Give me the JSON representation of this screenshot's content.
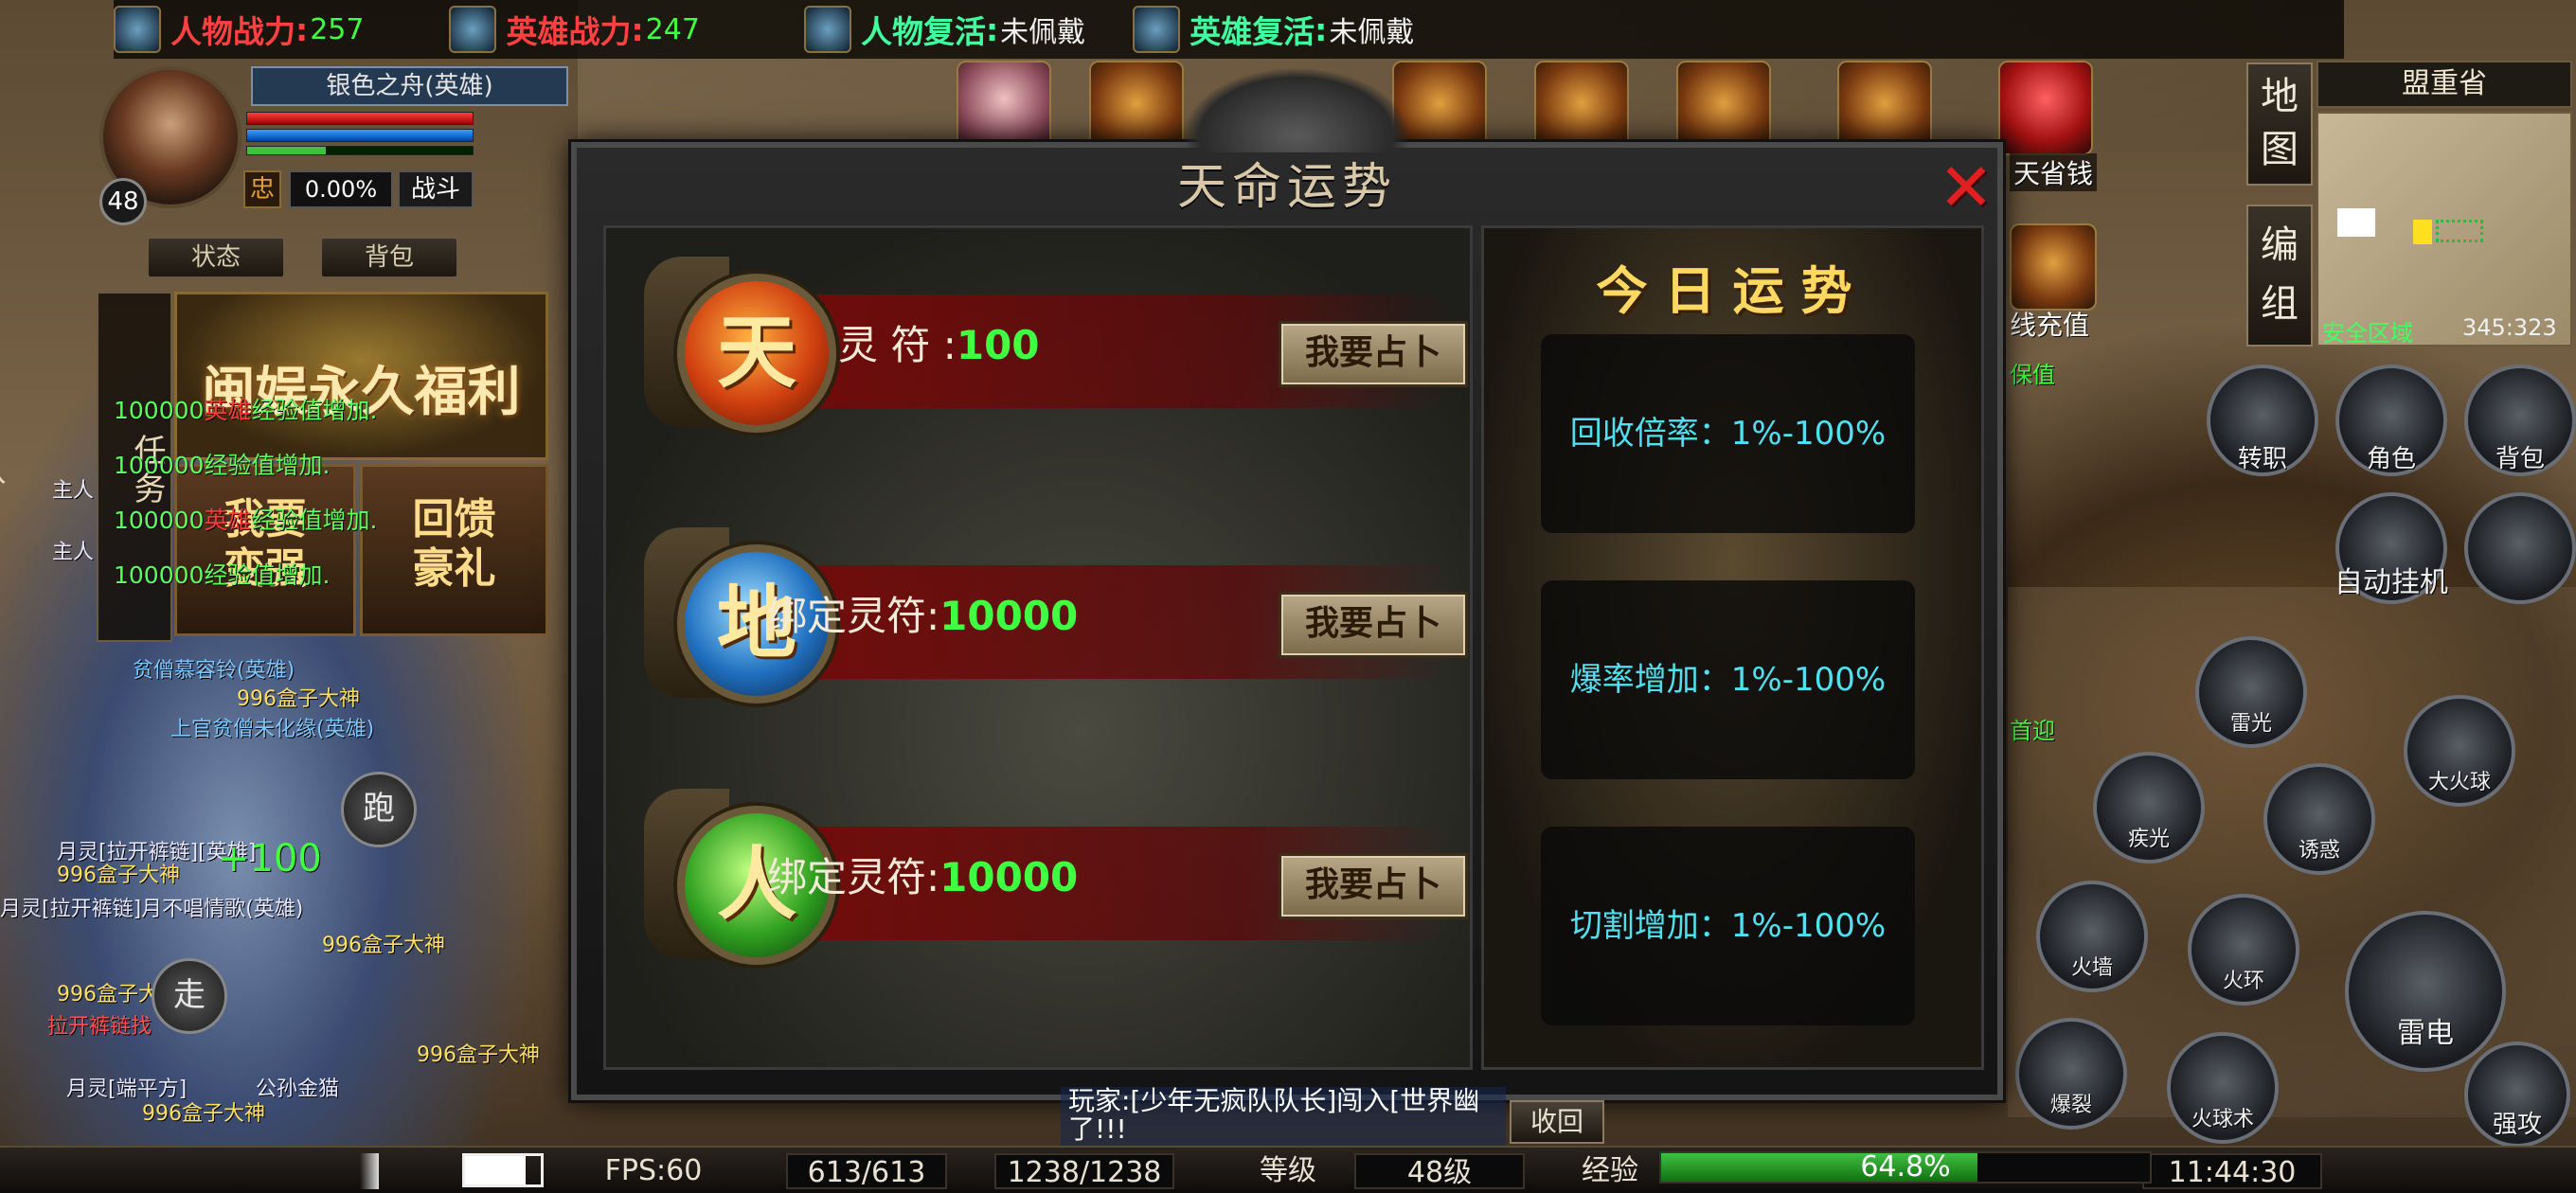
{
  "top_stats": [
    {
      "label": "人物战力",
      "value": "257",
      "label_color": "#ff4040",
      "value_color": "#40ff40",
      "icon": "dragon-icon"
    },
    {
      "label": "英雄战力",
      "value": "247",
      "label_color": "#ff4040",
      "value_color": "#40ff40",
      "icon": "flame-icon"
    },
    {
      "label": "人物复活",
      "value": "未佩戴",
      "label_color": "#40ffa0",
      "value_color": "#f0f0f0",
      "icon": "jade-icon"
    },
    {
      "label": "英雄复活",
      "value": "未佩戴",
      "label_color": "#40ffa0",
      "value_color": "#f0f0f0",
      "icon": "swirl-icon"
    }
  ],
  "hero": {
    "name": "银色之舟(英雄)",
    "level": "48",
    "loyalty_icon": "忠",
    "loyalty_pct": "0.00%",
    "mode": "战斗",
    "hp_fill": 1.0,
    "mp_fill": 1.0,
    "exp_fill": 0.35,
    "status_btn": "状态",
    "bag_btn": "背包"
  },
  "left_panel": {
    "task_tab": "任务",
    "team_tab": "队",
    "promo_main": "闽娱永久福利",
    "promo_a": [
      "我要",
      "变强"
    ],
    "promo_b": [
      "回馈",
      "豪礼"
    ]
  },
  "system_log": [
    {
      "amount": "100000",
      "hero": "英雄",
      "text": "经验值增加."
    },
    {
      "amount": "100000",
      "hero": "",
      "text": "经验值增加."
    },
    {
      "amount": "100000",
      "hero": "英雄",
      "text": "经验值增加."
    },
    {
      "amount": "100000",
      "hero": "",
      "text": "经验值增加."
    }
  ],
  "float_names": [
    {
      "text": "主人",
      "cls": "w"
    },
    {
      "text": "主人",
      "cls": "w"
    },
    {
      "text": "贫僧慕容铃(英雄)",
      "cls": "b"
    },
    {
      "text": "996盒子大神",
      "cls": ""
    },
    {
      "text": "上官贫僧未化缘(英雄)",
      "cls": "b"
    },
    {
      "text": "月灵[拉开裤链][英雄]",
      "cls": "w"
    },
    {
      "text": "996盒子大神",
      "cls": ""
    },
    {
      "text": "月灵[拉开裤链]月不唱情歌(英雄)",
      "cls": "w"
    },
    {
      "text": "996盒子大神",
      "cls": ""
    },
    {
      "text": "996盒子大神",
      "cls": ""
    },
    {
      "text": "拉开裤链找",
      "cls": "rr"
    },
    {
      "text": "月灵[端平方]",
      "cls": "w"
    },
    {
      "text": "公孙金猫",
      "cls": "w"
    },
    {
      "text": "996盒子大神",
      "cls": ""
    },
    {
      "text": "996盒子大神",
      "cls": ""
    },
    {
      "text": "+100",
      "cls": ""
    }
  ],
  "left_round_buttons": [
    "跑",
    "走"
  ],
  "minimap": {
    "map_btn": [
      "地",
      "图"
    ],
    "group_btn": [
      "编",
      "组"
    ],
    "name": "盟重省",
    "zone": "安全区域",
    "coords": "345:323"
  },
  "side_labels": [
    "天省钱",
    "线充值",
    "保值",
    "首迎"
  ],
  "right_actions": [
    {
      "label": "转职",
      "icon": "portrait-icon"
    },
    {
      "label": "角色",
      "icon": "helmet-icon"
    },
    {
      "label": "背包",
      "icon": "bag-icon"
    },
    {
      "label": "自动挂机",
      "icon": "dagger-icon"
    },
    {
      "label": "",
      "icon": "dpad-icon"
    }
  ],
  "skills": [
    {
      "label": "雷光",
      "icon": "thunder-icon"
    },
    {
      "label": "大火球",
      "icon": "fireball-icon"
    },
    {
      "label": "疾光",
      "icon": "lightning-icon"
    },
    {
      "label": "诱惑",
      "icon": "lure-icon"
    },
    {
      "label": "火墙",
      "icon": "firewall-icon"
    },
    {
      "label": "火环",
      "icon": "firering-icon"
    },
    {
      "label": "雷电",
      "icon": "thunderbolt-icon"
    },
    {
      "label": "爆裂",
      "icon": "explode-icon"
    },
    {
      "label": "火球术",
      "icon": "fireball-small-icon"
    },
    {
      "label": "强攻",
      "icon": "sword-icon"
    }
  ],
  "dialog": {
    "title": "天命运势",
    "close_icon": "close-x-icon",
    "rows": [
      {
        "glyph": "天",
        "label": "灵  符 :",
        "value": "100",
        "button": "我要占卜",
        "orb": "tian"
      },
      {
        "glyph": "地",
        "label": "绑定灵符:",
        "value": "10000",
        "button": "我要占卜",
        "orb": "di"
      },
      {
        "glyph": "人",
        "label": "绑定灵符:",
        "value": "10000",
        "button": "我要占卜",
        "orb": "ren"
      }
    ],
    "fortune_title": "今日运势",
    "fortunes": [
      "回收倍率：1%-100%",
      "爆率增加：1%-100%",
      "切割增加：1%-100%"
    ]
  },
  "chat": {
    "text": "玩家:[少年无疯队队长]闯入[世界幽"
  },
  "recall_btn": "收回",
  "bottom_bar": {
    "fps": "FPS:60",
    "hp": "613/613",
    "mp": "1238/1238",
    "level_label": "等级",
    "level": "48级",
    "exp_label": "经验",
    "exp_pct": "64.8%",
    "exp_fill": 0.648,
    "time": "11:44:30"
  }
}
